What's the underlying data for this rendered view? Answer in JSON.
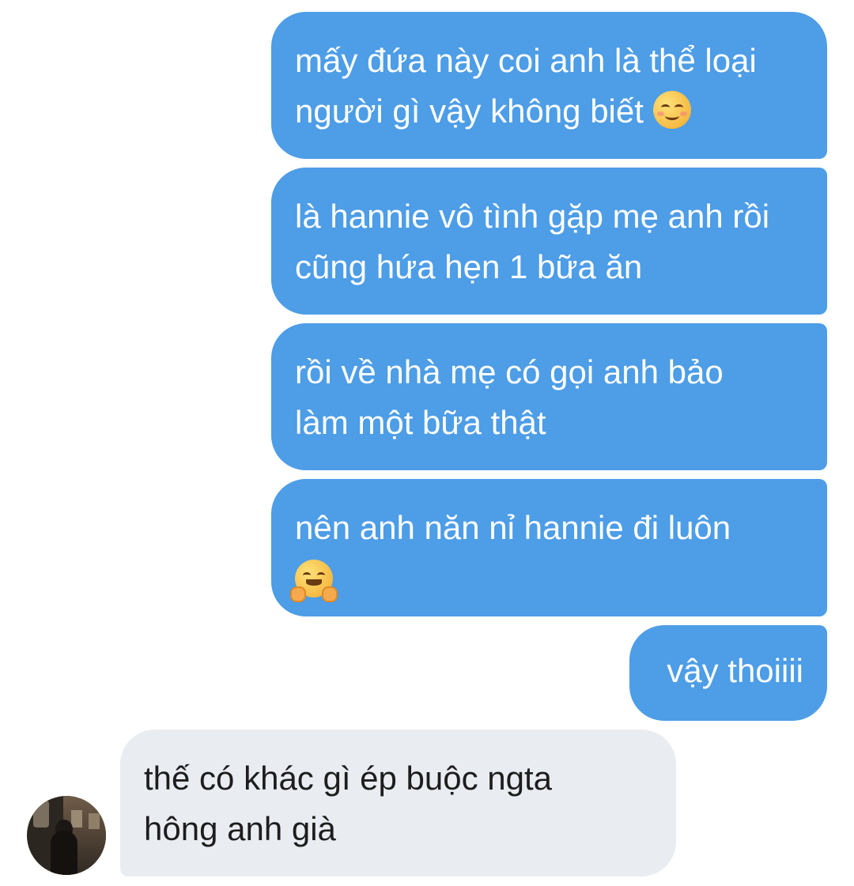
{
  "messages": [
    {
      "direction": "sent",
      "lines": [
        "mấy đứa này coi anh là thể loại",
        "người gì vậy không biết"
      ],
      "emoji": "smiling-face-with-blush"
    },
    {
      "direction": "sent",
      "lines": [
        "là hannie vô tình gặp mẹ anh rồi",
        "cũng hứa hẹn 1 bữa ăn"
      ]
    },
    {
      "direction": "sent",
      "lines": [
        "rồi về nhà mẹ có gọi anh bảo",
        "làm một bữa thật"
      ]
    },
    {
      "direction": "sent",
      "lines": [
        "nên anh năn nỉ hannie đi luôn"
      ],
      "emoji": "hugging-face"
    },
    {
      "direction": "sent",
      "lines": [
        "vậy thoiiii"
      ]
    },
    {
      "direction": "received",
      "lines": [
        "thế có khác gì ép buộc ngta",
        "hông anh già"
      ]
    }
  ],
  "colors": {
    "sent_bubble": "#4d9de7",
    "received_bubble": "#e9ecf1",
    "sent_text": "#ffffff",
    "received_text": "#1d1d1d"
  },
  "avatar": {
    "icon": "contact-avatar-photo"
  }
}
